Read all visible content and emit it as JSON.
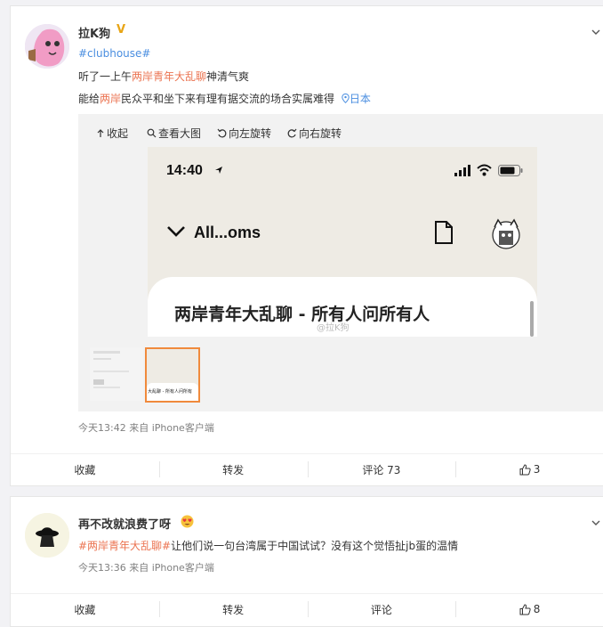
{
  "post1": {
    "username": "拉K狗",
    "hashtag": "#clubhouse#",
    "line1_pre": "听了一上午",
    "line1_link": "两岸青年大乱聊",
    "line1_post": "神清气爽",
    "line2_pre": "能给",
    "line2_link": "两岸",
    "line2_post": "民众平和坐下来有理有据交流的场合实属难得",
    "location": "日本",
    "toolbar": {
      "collapse": "收起",
      "view_large": "查看大图",
      "rotate_left": "向左旋转",
      "rotate_right": "向右旋转"
    },
    "screenshot": {
      "time": "14:40",
      "room_name": "All...oms",
      "room_title": "两岸青年大乱聊 - 所有人问所有人",
      "watermark": "@拉K狗"
    },
    "thumb_caption": "大乱聊 - 所有人问所有",
    "meta": "今天13:42  来自 iPhone客户端",
    "actions": {
      "favorite": "收藏",
      "repost": "转发",
      "comment": "评论 73",
      "like_count": "3"
    }
  },
  "post2": {
    "username": "再不改就浪费了呀",
    "hashtag": "#两岸青年大乱聊#",
    "text": "让他们说一句台湾属于中国试试？没有这个觉悟扯jb蛋的温情",
    "meta": "今天13:36  来自 iPhone客户端",
    "actions": {
      "favorite": "收藏",
      "repost": "转发",
      "comment": "评论",
      "like_count": "8"
    }
  },
  "colors": {
    "link": "#eb7350",
    "tag": "#4a8ee0",
    "badge": "#e8a516",
    "thumb_border": "#f08a3c"
  }
}
